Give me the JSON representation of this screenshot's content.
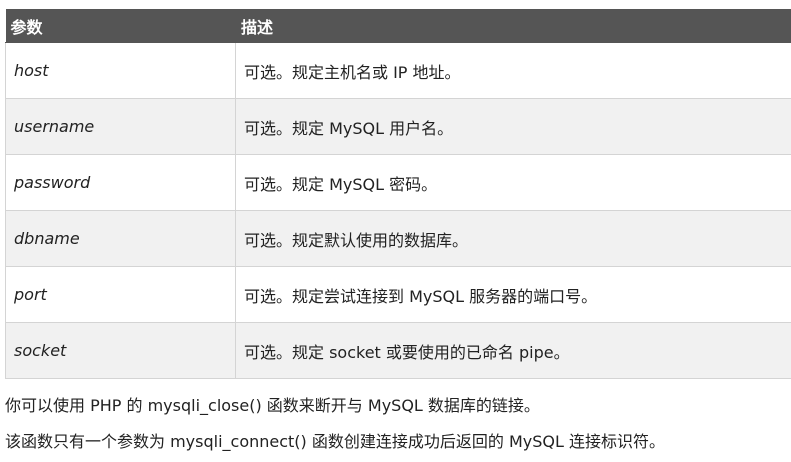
{
  "table": {
    "headers": [
      "参数",
      "描述"
    ],
    "rows": [
      {
        "param": "host",
        "desc": "可选。规定主机名或 IP 地址。"
      },
      {
        "param": "username",
        "desc": "可选。规定 MySQL 用户名。"
      },
      {
        "param": "password",
        "desc": "可选。规定 MySQL 密码。"
      },
      {
        "param": "dbname",
        "desc": "可选。规定默认使用的数据库。"
      },
      {
        "param": "port",
        "desc": "可选。规定尝试连接到 MySQL 服务器的端口号。"
      },
      {
        "param": "socket",
        "desc": "可选。规定 socket 或要使用的已命名 pipe。"
      }
    ]
  },
  "notes": [
    "你可以使用 PHP 的 mysqli_close() 函数来断开与 MySQL 数据库的链接。",
    "该函数只有一个参数为 mysqli_connect() 函数创建连接成功后返回的 MySQL 连接标识符。"
  ]
}
